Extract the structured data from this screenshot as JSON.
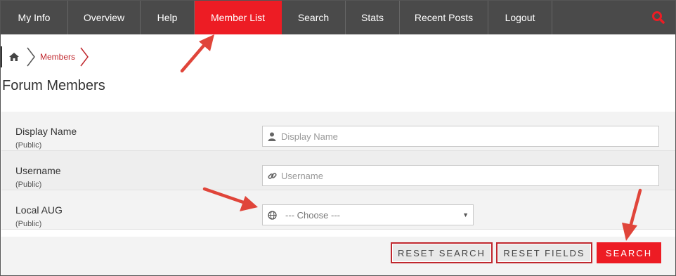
{
  "nav": {
    "items": [
      {
        "label": "My Info"
      },
      {
        "label": "Overview"
      },
      {
        "label": "Help"
      },
      {
        "label": "Member List",
        "active": true
      },
      {
        "label": "Search"
      },
      {
        "label": "Stats"
      },
      {
        "label": "Recent Posts"
      },
      {
        "label": "Logout"
      }
    ],
    "search_icon": "search-icon"
  },
  "breadcrumb": {
    "home_icon": "home-icon",
    "members_label": "Members"
  },
  "page": {
    "title": "Forum Members"
  },
  "form": {
    "display_name": {
      "label": "Display Name",
      "sub": "(Public)",
      "placeholder": "Display Name",
      "value": "",
      "icon": "user-icon"
    },
    "username": {
      "label": "Username",
      "sub": "(Public)",
      "placeholder": "Username",
      "value": "",
      "icon": "link-icon"
    },
    "local_aug": {
      "label": "Local AUG",
      "sub": "(Public)",
      "selected": "--- Choose ---",
      "icon": "globe-icon"
    }
  },
  "actions": {
    "reset_search": "RESET SEARCH",
    "reset_fields": "RESET FIELDS",
    "search": "SEARCH"
  },
  "colors": {
    "nav_bg": "#4a4a4a",
    "accent": "#ed1c24",
    "annotation_arrow": "#e0453a"
  }
}
